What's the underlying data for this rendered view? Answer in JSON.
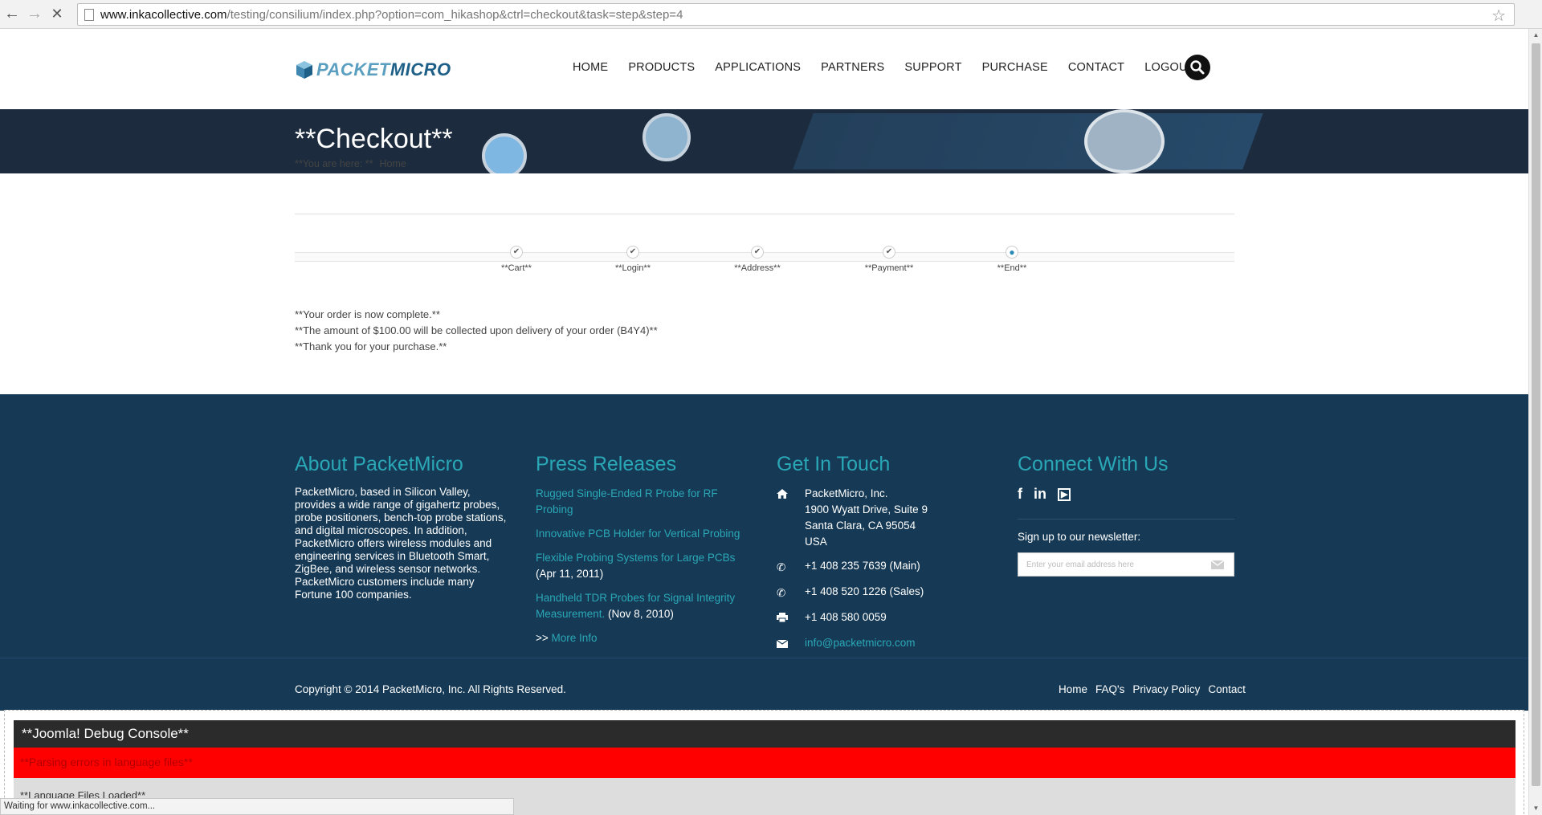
{
  "browser": {
    "url_host": "www.inkacollective.com",
    "url_path": "/testing/consilium/index.php?option=com_hikashop&ctrl=checkout&task=step&step=4",
    "status_text": "Waiting for www.inkacollective.com..."
  },
  "header": {
    "logo_part1": "PACKET",
    "logo_part2": "MICRO",
    "nav": [
      "HOME",
      "PRODUCTS",
      "APPLICATIONS",
      "PARTNERS",
      "SUPPORT",
      "PURCHASE",
      "CONTACT",
      "LOGOUT"
    ]
  },
  "banner": {
    "title": "**Checkout**"
  },
  "breadcrumb": {
    "prefix": "**You are here: **",
    "home": "Home"
  },
  "steps": [
    {
      "label": "**Cart**",
      "state": "done"
    },
    {
      "label": "**Login**",
      "state": "done"
    },
    {
      "label": "**Address**",
      "state": "done"
    },
    {
      "label": "**Payment**",
      "state": "done"
    },
    {
      "label": "**End**",
      "state": "current"
    }
  ],
  "messages": {
    "line1": "**Your order is now complete.**",
    "line2": "**The amount of $100.00 will be collected upon delivery of your order (B4Y4)**",
    "line3": "**Thank you for your purchase.**"
  },
  "footer": {
    "about_title": "About PacketMicro",
    "about_text": "PacketMicro, based in Silicon Valley, provides a wide range of gigahertz probes, probe positioners, bench-top probe stations, and digital microscopes. In addition, PacketMicro offers wireless modules and engineering services in Bluetooth Smart, ZigBee, and wireless sensor networks. PacketMicro customers include many Fortune 100 companies.",
    "press_title": "Press Releases",
    "press": [
      {
        "link": "Rugged Single-Ended R Probe for RF Probing",
        "date": ""
      },
      {
        "link": "Innovative PCB Holder for Vertical Probing",
        "date": ""
      },
      {
        "link": "Flexible Probing Systems for Large PCBs",
        "date": " (Apr 11, 2011)"
      },
      {
        "link": "Handheld TDR Probes for Signal Integrity Measurement.",
        "date": " (Nov 8, 2010)"
      }
    ],
    "more_prefix": ">> ",
    "more_link": "More Info",
    "contact_title": "Get In Touch",
    "address": [
      "PacketMicro, Inc.",
      "1900 Wyatt Drive, Suite 9",
      "Santa Clara, CA 95054",
      "USA"
    ],
    "phone_main": "+1 408 235 7639 (Main)",
    "phone_sales": "+1 408 520 1226 (Sales)",
    "fax": "+1 408 580 0059",
    "email": "info@packetmicro.com",
    "connect_title": "Connect With Us",
    "newsletter_label": "Sign up to our newsletter:",
    "newsletter_placeholder": "Enter your email address here",
    "copyright": "Copyright © 2014 PacketMicro, Inc. All Rights Reserved.",
    "links": [
      "Home",
      "FAQ's",
      "Privacy Policy",
      "Contact"
    ]
  },
  "debug": {
    "title": "**Joomla! Debug Console**",
    "error": "**Parsing errors in language files**",
    "next": "**Language Files Loaded**"
  },
  "colors": {
    "accent": "#2aa7b6",
    "footer_bg": "#163a55",
    "error_bg": "#ff0000"
  }
}
